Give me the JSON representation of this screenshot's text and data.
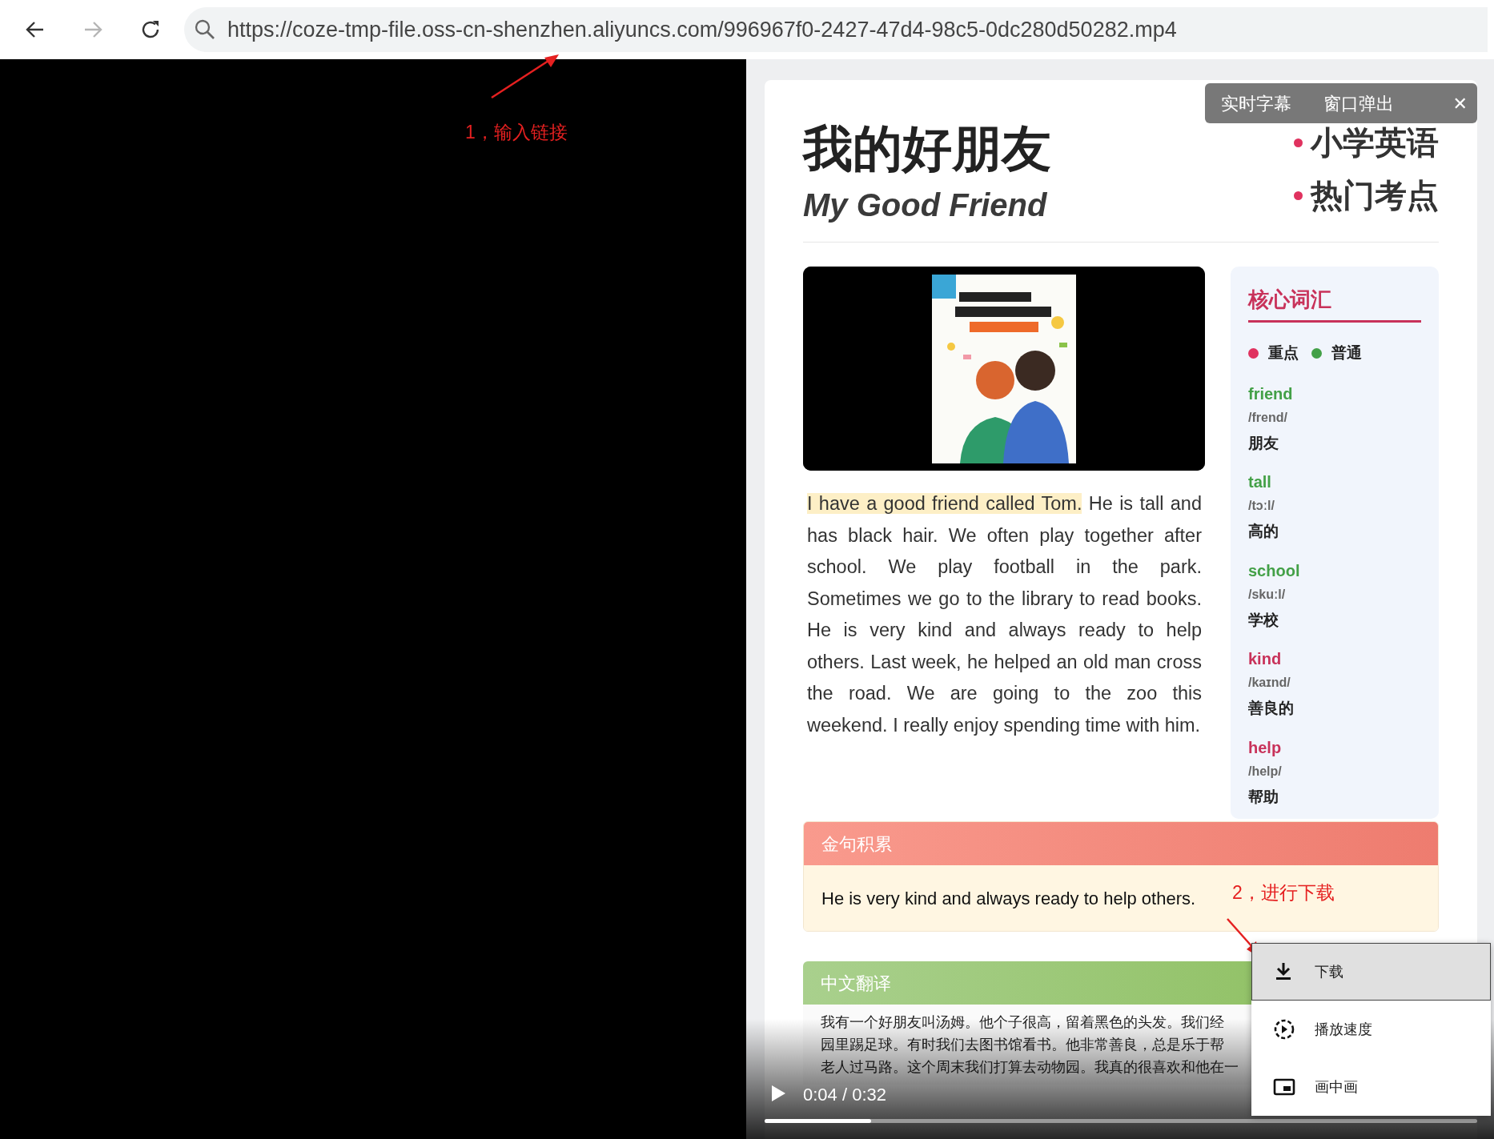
{
  "browser": {
    "buttons": [
      {
        "kind": "back",
        "disabled": false
      },
      {
        "kind": "forward",
        "disabled": true
      },
      {
        "kind": "reload",
        "disabled": false
      }
    ],
    "url": "https://coze-tmp-file.oss-cn-shenzhen.aliyuncs.com/996967f0-2427-47d4-98c5-0dc280d50282.mp4"
  },
  "annotations": [
    {
      "text": "1，输入链接"
    },
    {
      "text": "2，进行下载"
    }
  ],
  "page": {
    "title_cn": "我的好朋友",
    "title_en": "My Good Friend",
    "tags": [
      "小学英语",
      "热门考点"
    ],
    "story_highlight": "I have a good friend called Tom.",
    "story_rest": "He is tall and has black hair. We often play together after school. We play football in the park. Sometimes we go to the library to read books. He is very kind and always ready to help others. Last week, he helped an old man cross the road. We are going to the zoo this weekend. I really enjoy spending time with him."
  },
  "vocab": {
    "title": "核心词汇",
    "legend": [
      {
        "label": "重点",
        "color": "#e0325f"
      },
      {
        "label": "普通",
        "color": "#43a047"
      }
    ],
    "words": [
      {
        "word": "friend",
        "phonetic": "/frend/",
        "meaning": "朋友",
        "color": "#43a047"
      },
      {
        "word": "tall",
        "phonetic": "/tɔːl/",
        "meaning": "高的",
        "color": "#43a047"
      },
      {
        "word": "school",
        "phonetic": "/skuːl/",
        "meaning": "学校",
        "color": "#43a047"
      },
      {
        "word": "kind",
        "phonetic": "/kaɪnd/",
        "meaning": "善良的",
        "color": "#c8325a"
      },
      {
        "word": "help",
        "phonetic": "/help/",
        "meaning": "帮助",
        "color": "#c8325a"
      }
    ]
  },
  "quote": {
    "title": "金句积累",
    "text": "He is very kind and always ready to help others."
  },
  "translation": {
    "title": "中文翻译",
    "lines": [
      "我有一个好朋友叫汤姆。他个子很高，留着黑色的头发。我们经",
      "园里踢足球。有时我们去图书馆看书。他非常善良，总是乐于帮",
      "老人过马路。这个周末我们打算去动物园。我真的很喜欢和他在一"
    ]
  },
  "caption_bar": {
    "items": [
      "实时字幕",
      "窗口弹出"
    ],
    "close": "✕"
  },
  "player": {
    "playing": false,
    "time": "0:04 / 0:32",
    "level": 0.149
  },
  "menu": [
    {
      "kind": "download",
      "label": "下载",
      "selected": true
    },
    {
      "kind": "speed",
      "label": "播放速度",
      "selected": false
    },
    {
      "kind": "pip",
      "label": "画中画",
      "selected": false
    }
  ]
}
